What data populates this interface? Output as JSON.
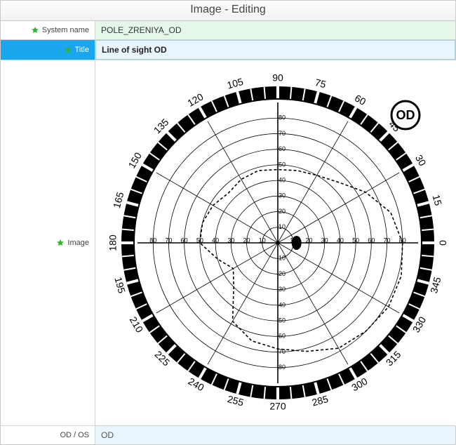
{
  "header": {
    "title": "Image - Editing"
  },
  "fields": {
    "system_name": {
      "label": "System name",
      "value": "POLE_ZRENIYA_OD"
    },
    "title": {
      "label": "Title",
      "value": "Line of sight OD"
    },
    "image": {
      "label": "Image"
    },
    "odos": {
      "label": "OD / OS",
      "value": "OD"
    }
  },
  "chart_data": {
    "type": "polar",
    "title": "Line of sight OD",
    "eye_label": "OD",
    "radial_ticks": [
      10,
      20,
      30,
      40,
      50,
      60,
      70,
      80
    ],
    "radial_max": 90,
    "angle_ticks_deg": [
      0,
      15,
      30,
      45,
      60,
      75,
      90,
      105,
      120,
      135,
      150,
      165,
      180,
      195,
      210,
      225,
      240,
      255,
      270,
      285,
      300,
      315,
      330,
      345
    ],
    "axis_readout_values": [
      10,
      20,
      30,
      40,
      50,
      60,
      70,
      80
    ],
    "blind_spot": {
      "angle_deg": 0,
      "radius": 12
    },
    "series": [
      {
        "name": "isopter",
        "points_angle_radius": [
          [
            0,
            80
          ],
          [
            15,
            75
          ],
          [
            30,
            65
          ],
          [
            45,
            55
          ],
          [
            60,
            50
          ],
          [
            75,
            48
          ],
          [
            90,
            47
          ],
          [
            105,
            48
          ],
          [
            120,
            47
          ],
          [
            135,
            45
          ],
          [
            150,
            48
          ],
          [
            165,
            50
          ],
          [
            180,
            50
          ],
          [
            195,
            40
          ],
          [
            210,
            33
          ],
          [
            225,
            40
          ],
          [
            240,
            58
          ],
          [
            255,
            65
          ],
          [
            270,
            68
          ],
          [
            285,
            72
          ],
          [
            300,
            78
          ],
          [
            315,
            80
          ],
          [
            330,
            82
          ],
          [
            345,
            82
          ]
        ]
      }
    ]
  }
}
